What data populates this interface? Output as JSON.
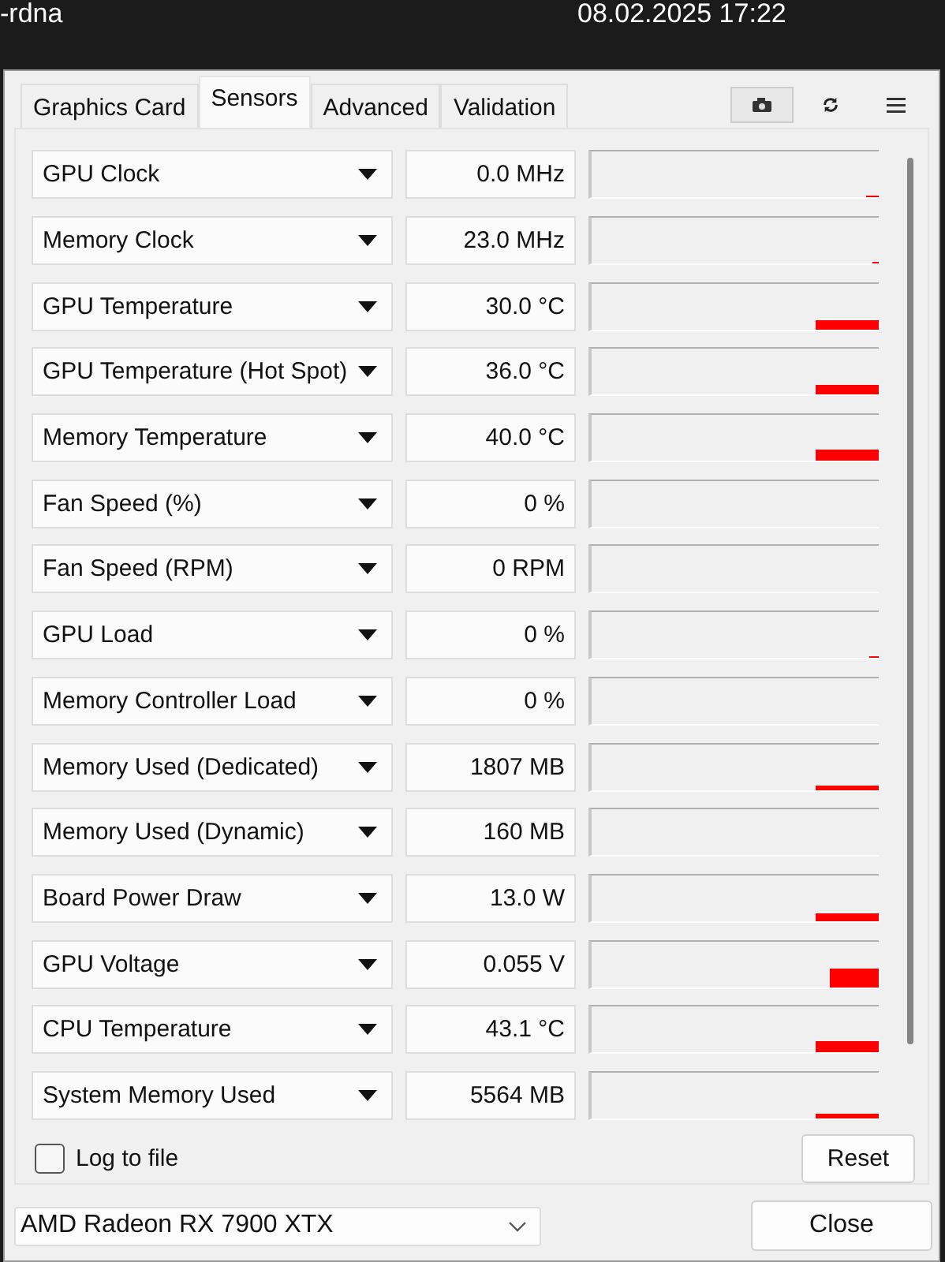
{
  "background": {
    "file_name": "-rdna",
    "date": "08.02.2025 17:22"
  },
  "tabs": [
    {
      "label": "Graphics Card",
      "selected": false
    },
    {
      "label": "Sensors",
      "selected": true
    },
    {
      "label": "Advanced",
      "selected": false
    },
    {
      "label": "Validation",
      "selected": false
    }
  ],
  "sensors": [
    {
      "name": "GPU Clock",
      "value": "0.0 MHz"
    },
    {
      "name": "Memory Clock",
      "value": "23.0 MHz"
    },
    {
      "name": "GPU Temperature",
      "value": "30.0 °C"
    },
    {
      "name": "GPU Temperature (Hot Spot)",
      "value": "36.0 °C"
    },
    {
      "name": "Memory Temperature",
      "value": "40.0 °C"
    },
    {
      "name": "Fan Speed (%)",
      "value": "0 %"
    },
    {
      "name": "Fan Speed (RPM)",
      "value": "0 RPM"
    },
    {
      "name": "GPU Load",
      "value": "0 %"
    },
    {
      "name": "Memory Controller Load",
      "value": "0 %"
    },
    {
      "name": "Memory Used (Dedicated)",
      "value": "1807 MB"
    },
    {
      "name": "Memory Used (Dynamic)",
      "value": "160 MB"
    },
    {
      "name": "Board Power Draw",
      "value": "13.0 W"
    },
    {
      "name": "GPU Voltage",
      "value": "0.055 V"
    },
    {
      "name": "CPU Temperature",
      "value": "43.1 °C"
    },
    {
      "name": "System Memory Used",
      "value": "5564 MB"
    }
  ],
  "log_to_file": {
    "label": "Log to file",
    "checked": false
  },
  "reset_button": "Reset",
  "gpu_select": {
    "value": "AMD Radeon RX 7900 XTX"
  },
  "close_button": "Close"
}
